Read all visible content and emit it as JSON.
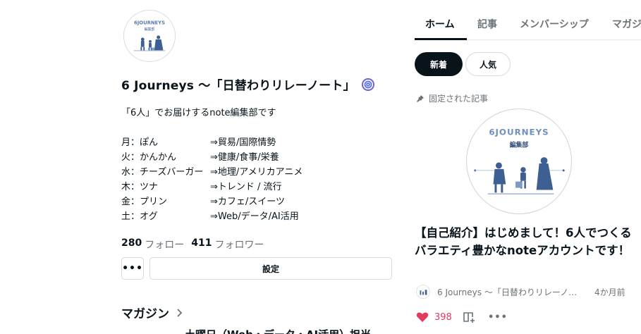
{
  "profile": {
    "avatar_text": "6JOURNEYS",
    "avatar_subtext": "編集部",
    "name": "6 Journeys 〜「日替わりリレーノート」",
    "badge_icon": "swirl-badge-icon",
    "description": "「6人」でお届けするnote編集部です",
    "schedule": [
      {
        "day": "月：ぽん",
        "topic": "⇒貿易/国際情勢"
      },
      {
        "day": "火：かんかん",
        "topic": "⇒健康/食事/栄養"
      },
      {
        "day": "水：チーズバーガー",
        "topic": "⇒地理/アメリカアニメ"
      },
      {
        "day": "木：ツナ",
        "topic": "⇒トレンド / 流行"
      },
      {
        "day": "金：プリン",
        "topic": "⇒カフェ/スイーツ"
      },
      {
        "day": "土：オグ",
        "topic": "⇒Web/データ/AI活用"
      }
    ],
    "following_count": "280",
    "following_label": "フォロー",
    "followers_count": "411",
    "followers_label": "フォロワー",
    "more_label": "•••",
    "settings_label": "設定"
  },
  "magazine": {
    "heading": "マガジン",
    "first_item": "土曜日（Web・データ・AI活用）担当"
  },
  "tabs": [
    {
      "label": "ホーム",
      "active": true
    },
    {
      "label": "記事",
      "active": false
    },
    {
      "label": "メンバーシップ",
      "active": false
    },
    {
      "label": "マガジ",
      "active": false
    }
  ],
  "sort": {
    "new_label": "新着",
    "popular_label": "人気"
  },
  "pinned": {
    "label": "固定された記事",
    "thumb_text": "6JOURNEYS",
    "thumb_subtext": "編集部",
    "title": "【自己紹介】はじめまして！6人でつくるバラエティ豊かなnoteアカウントです！",
    "author": "6 Journeys 〜「日替わりリレーノー…",
    "time_ago": "4か月前",
    "likes": "398",
    "more_label": "•••"
  },
  "colors": {
    "text": "#08131a",
    "muted": "#6b7378",
    "like": "#e23b5d",
    "illustration": "#3d5f91"
  }
}
